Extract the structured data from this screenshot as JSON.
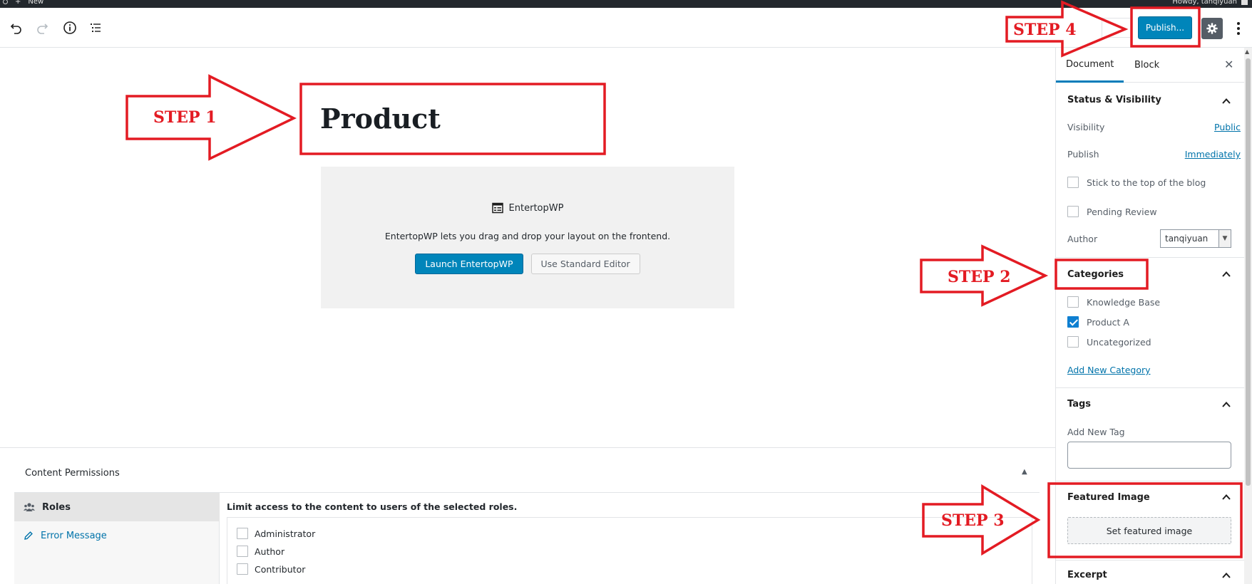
{
  "colors": {
    "accent": "#0085ba",
    "annotation": "#e31b23",
    "link": "#0073aa"
  },
  "admin_bar": {
    "new_label": "New",
    "howdy_label": "Howdy, tanqiyuan"
  },
  "header": {
    "publish_label": "Publish...",
    "icons": [
      "undo-icon",
      "redo-icon",
      "info-icon",
      "list-view-icon",
      "gear-icon",
      "more-vertical-icon"
    ]
  },
  "editor": {
    "post_title": "Product",
    "block": {
      "icon": "table-icon",
      "name": "EntertopWP",
      "description": "EntertopWP lets you drag and drop your layout on the frontend.",
      "launch_label": "Launch EntertopWP",
      "standard_label": "Use Standard Editor"
    }
  },
  "metabox": {
    "title": "Content Permissions",
    "tabs": [
      {
        "label": "Roles",
        "icon": "users-icon"
      },
      {
        "label": "Error Message",
        "icon": "pencil-icon"
      }
    ],
    "description": "Limit access to the content to users of the selected roles.",
    "roles": [
      "Administrator",
      "Author",
      "Contributor"
    ]
  },
  "sidebar": {
    "tabs": [
      "Document",
      "Block"
    ],
    "status": {
      "title": "Status & Visibility",
      "visibility_label": "Visibility",
      "visibility_value": "Public",
      "publish_label": "Publish",
      "publish_value": "Immediately",
      "stick_label": "Stick to the top of the blog",
      "pending_label": "Pending Review",
      "author_label": "Author",
      "author_value": "tanqiyuan"
    },
    "categories": {
      "title": "Categories",
      "items": [
        {
          "label": "Knowledge Base",
          "checked": false
        },
        {
          "label": "Product A",
          "checked": true
        },
        {
          "label": "Uncategorized",
          "checked": false
        }
      ],
      "add_new": "Add New Category"
    },
    "tags": {
      "title": "Tags",
      "add_label": "Add New Tag"
    },
    "featured": {
      "title": "Featured Image",
      "button": "Set featured image"
    },
    "excerpt": {
      "title": "Excerpt"
    }
  },
  "annotations": {
    "steps": [
      "STEP 1",
      "STEP 2",
      "STEP 3",
      "STEP 4"
    ]
  }
}
